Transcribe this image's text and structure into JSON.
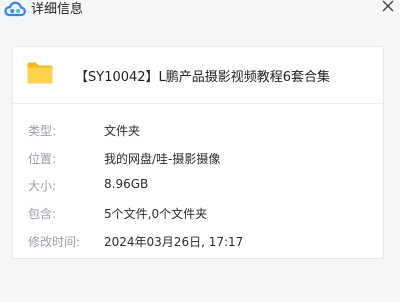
{
  "window": {
    "title": "详细信息",
    "close_icon": "close-icon",
    "app_icon": "cloud-icon",
    "accent_color": "#2f83ff"
  },
  "file": {
    "name": "【SY10042】L鹏产品摄影视频教程6套合集",
    "icon": "folder-icon",
    "icon_color": "#f7c531"
  },
  "details": [
    {
      "label": "类型:",
      "value": "文件夹"
    },
    {
      "label": "位置:",
      "value": "我的网盘/哇-摄影摄像"
    },
    {
      "label": "大小:",
      "value": "8.96GB"
    },
    {
      "label": "包含:",
      "value": "5个文件,0个文件夹"
    },
    {
      "label": "修改时间:",
      "value": "2024年03月26日, 17:17"
    }
  ]
}
